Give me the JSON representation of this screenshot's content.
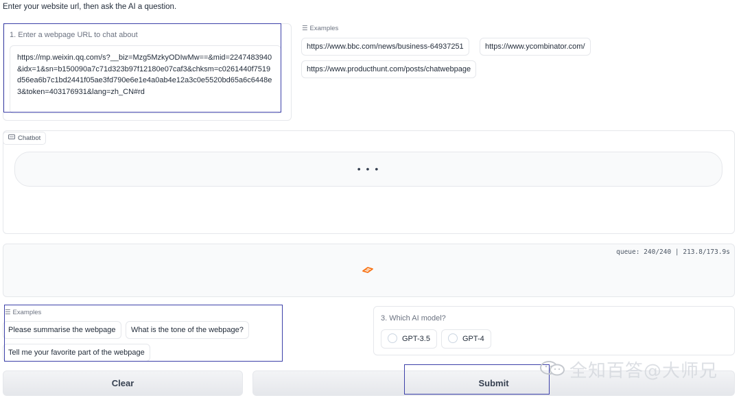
{
  "intro": "Enter your website url, then ask the AI a question.",
  "url_input": {
    "label": "1. Enter a webpage URL to chat about",
    "value": "https://mp.weixin.qq.com/s?__biz=Mzg5MzkyODIwMw==&mid=2247483940&idx=1&sn=b150090a7c71d323b97f12180e07caf3&chksm=c0261440f7519d56ea6b7c1bd2441f05ae3fd790e6e1e4a0ab4e12a3c0e5520bd65a6c6448e3&token=403176931&lang=zh_CN#rd"
  },
  "url_examples": {
    "label": "Examples",
    "items": [
      "https://www.bbc.com/news/business-64937251",
      "https://www.ycombinator.com/",
      "https://www.producthunt.com/posts/chatwebpage"
    ]
  },
  "chatbot": {
    "label": "Chatbot",
    "pending": "• • •"
  },
  "status": {
    "queue": "queue: 240/240 | 213.8/173.9s"
  },
  "question_examples": {
    "label": "Examples",
    "items": [
      "Please summarise the webpage",
      "What is the tone of the webpage?",
      "Tell me your favorite part of the webpage"
    ]
  },
  "model_select": {
    "label": "3. Which AI model?",
    "options": [
      "GPT-3.5",
      "GPT-4"
    ]
  },
  "buttons": {
    "clear": "Clear",
    "submit": "Submit"
  },
  "watermark": "全知百答@大师兄",
  "colors": {
    "highlight": "#3b3fa8",
    "loader": "#f97316",
    "border": "#e5e7eb"
  }
}
